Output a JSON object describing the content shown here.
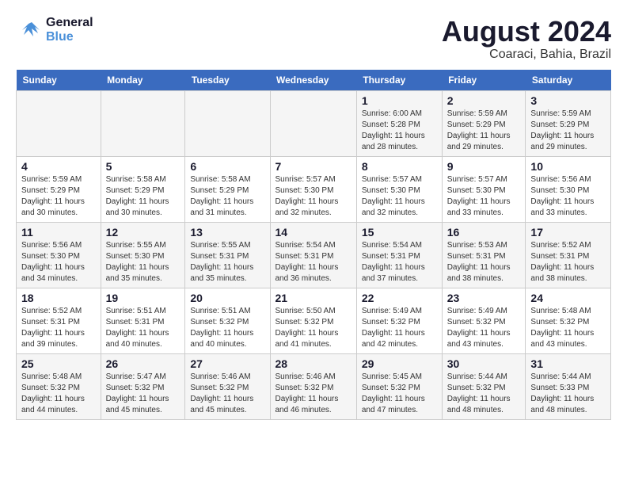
{
  "header": {
    "logo_line1": "General",
    "logo_line2": "Blue",
    "title": "August 2024",
    "subtitle": "Coaraci, Bahia, Brazil"
  },
  "days_of_week": [
    "Sunday",
    "Monday",
    "Tuesday",
    "Wednesday",
    "Thursday",
    "Friday",
    "Saturday"
  ],
  "weeks": [
    [
      {
        "num": "",
        "info": ""
      },
      {
        "num": "",
        "info": ""
      },
      {
        "num": "",
        "info": ""
      },
      {
        "num": "",
        "info": ""
      },
      {
        "num": "1",
        "info": "Sunrise: 6:00 AM\nSunset: 5:28 PM\nDaylight: 11 hours\nand 28 minutes."
      },
      {
        "num": "2",
        "info": "Sunrise: 5:59 AM\nSunset: 5:29 PM\nDaylight: 11 hours\nand 29 minutes."
      },
      {
        "num": "3",
        "info": "Sunrise: 5:59 AM\nSunset: 5:29 PM\nDaylight: 11 hours\nand 29 minutes."
      }
    ],
    [
      {
        "num": "4",
        "info": "Sunrise: 5:59 AM\nSunset: 5:29 PM\nDaylight: 11 hours\nand 30 minutes."
      },
      {
        "num": "5",
        "info": "Sunrise: 5:58 AM\nSunset: 5:29 PM\nDaylight: 11 hours\nand 30 minutes."
      },
      {
        "num": "6",
        "info": "Sunrise: 5:58 AM\nSunset: 5:29 PM\nDaylight: 11 hours\nand 31 minutes."
      },
      {
        "num": "7",
        "info": "Sunrise: 5:57 AM\nSunset: 5:30 PM\nDaylight: 11 hours\nand 32 minutes."
      },
      {
        "num": "8",
        "info": "Sunrise: 5:57 AM\nSunset: 5:30 PM\nDaylight: 11 hours\nand 32 minutes."
      },
      {
        "num": "9",
        "info": "Sunrise: 5:57 AM\nSunset: 5:30 PM\nDaylight: 11 hours\nand 33 minutes."
      },
      {
        "num": "10",
        "info": "Sunrise: 5:56 AM\nSunset: 5:30 PM\nDaylight: 11 hours\nand 33 minutes."
      }
    ],
    [
      {
        "num": "11",
        "info": "Sunrise: 5:56 AM\nSunset: 5:30 PM\nDaylight: 11 hours\nand 34 minutes."
      },
      {
        "num": "12",
        "info": "Sunrise: 5:55 AM\nSunset: 5:30 PM\nDaylight: 11 hours\nand 35 minutes."
      },
      {
        "num": "13",
        "info": "Sunrise: 5:55 AM\nSunset: 5:31 PM\nDaylight: 11 hours\nand 35 minutes."
      },
      {
        "num": "14",
        "info": "Sunrise: 5:54 AM\nSunset: 5:31 PM\nDaylight: 11 hours\nand 36 minutes."
      },
      {
        "num": "15",
        "info": "Sunrise: 5:54 AM\nSunset: 5:31 PM\nDaylight: 11 hours\nand 37 minutes."
      },
      {
        "num": "16",
        "info": "Sunrise: 5:53 AM\nSunset: 5:31 PM\nDaylight: 11 hours\nand 38 minutes."
      },
      {
        "num": "17",
        "info": "Sunrise: 5:52 AM\nSunset: 5:31 PM\nDaylight: 11 hours\nand 38 minutes."
      }
    ],
    [
      {
        "num": "18",
        "info": "Sunrise: 5:52 AM\nSunset: 5:31 PM\nDaylight: 11 hours\nand 39 minutes."
      },
      {
        "num": "19",
        "info": "Sunrise: 5:51 AM\nSunset: 5:31 PM\nDaylight: 11 hours\nand 40 minutes."
      },
      {
        "num": "20",
        "info": "Sunrise: 5:51 AM\nSunset: 5:32 PM\nDaylight: 11 hours\nand 40 minutes."
      },
      {
        "num": "21",
        "info": "Sunrise: 5:50 AM\nSunset: 5:32 PM\nDaylight: 11 hours\nand 41 minutes."
      },
      {
        "num": "22",
        "info": "Sunrise: 5:49 AM\nSunset: 5:32 PM\nDaylight: 11 hours\nand 42 minutes."
      },
      {
        "num": "23",
        "info": "Sunrise: 5:49 AM\nSunset: 5:32 PM\nDaylight: 11 hours\nand 43 minutes."
      },
      {
        "num": "24",
        "info": "Sunrise: 5:48 AM\nSunset: 5:32 PM\nDaylight: 11 hours\nand 43 minutes."
      }
    ],
    [
      {
        "num": "25",
        "info": "Sunrise: 5:48 AM\nSunset: 5:32 PM\nDaylight: 11 hours\nand 44 minutes."
      },
      {
        "num": "26",
        "info": "Sunrise: 5:47 AM\nSunset: 5:32 PM\nDaylight: 11 hours\nand 45 minutes."
      },
      {
        "num": "27",
        "info": "Sunrise: 5:46 AM\nSunset: 5:32 PM\nDaylight: 11 hours\nand 45 minutes."
      },
      {
        "num": "28",
        "info": "Sunrise: 5:46 AM\nSunset: 5:32 PM\nDaylight: 11 hours\nand 46 minutes."
      },
      {
        "num": "29",
        "info": "Sunrise: 5:45 AM\nSunset: 5:32 PM\nDaylight: 11 hours\nand 47 minutes."
      },
      {
        "num": "30",
        "info": "Sunrise: 5:44 AM\nSunset: 5:32 PM\nDaylight: 11 hours\nand 48 minutes."
      },
      {
        "num": "31",
        "info": "Sunrise: 5:44 AM\nSunset: 5:33 PM\nDaylight: 11 hours\nand 48 minutes."
      }
    ]
  ]
}
